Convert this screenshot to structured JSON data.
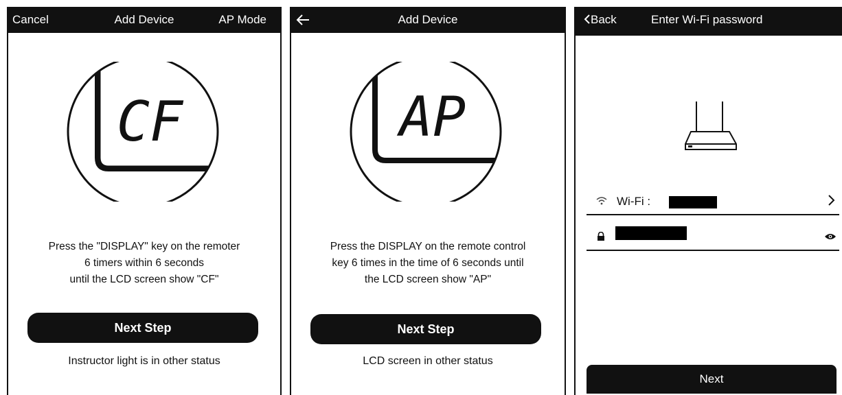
{
  "screen1": {
    "header": {
      "left": "Cancel",
      "title": "Add Device",
      "right": "AP Mode"
    },
    "lcd_text": "CF",
    "instruction": "Press the \"DISPLAY\" key on the remoter\n6 timers within 6 seconds\nuntil the LCD screen show \"CF\"",
    "next_button": "Next Step",
    "alt_link": "Instructor light is in other status"
  },
  "screen2": {
    "header": {
      "back_icon": "arrow-left-icon",
      "title": "Add Device"
    },
    "lcd_text": "AP",
    "instruction": "Press the DISPLAY on the remote control\nkey 6 times in the time of 6 seconds until\nthe LCD screen show \"AP\"",
    "next_button": "Next Step",
    "alt_link": "LCD screen in other status"
  },
  "screen3": {
    "header": {
      "back": "Back",
      "title": "Enter Wi-Fi password"
    },
    "wifi_label": "Wi-Fi :",
    "next_button": "Next",
    "icons": [
      "router-icon",
      "wifi-icon",
      "chevron-right-icon",
      "lock-icon",
      "eye-icon"
    ]
  },
  "colors": {
    "bar": "#111111",
    "background": "#ffffff"
  }
}
